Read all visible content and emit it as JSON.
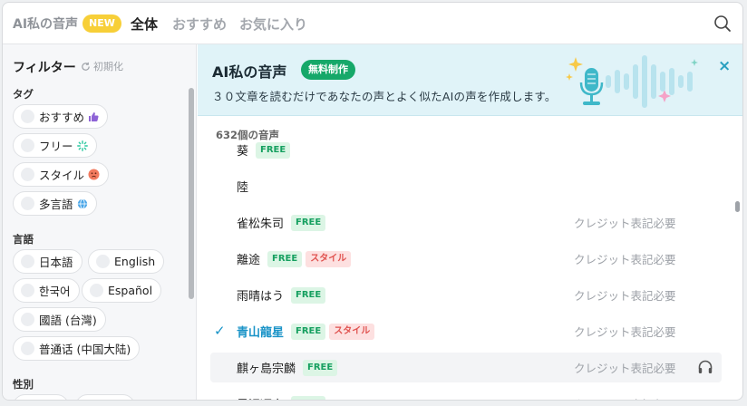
{
  "topbar": {
    "brand": "AI私の音声",
    "new_badge": "NEW",
    "tabs": [
      "全体",
      "おすすめ",
      "お気に入り"
    ]
  },
  "sidebar": {
    "filter_title": "フィルター",
    "reset_label": "初期化",
    "tag_section": "タグ",
    "tags": [
      "おすすめ",
      "フリー",
      "スタイル",
      "多言語"
    ],
    "language_section": "言語",
    "languages": [
      "日本語",
      "English",
      "한국어",
      "Español",
      "國語 (台灣)",
      "普通话 (中国大陆)"
    ],
    "gender_section": "性別"
  },
  "banner": {
    "title": "AI私の音声",
    "free_badge": "無料制作",
    "description": "３０文章を読むだけであなたの声とよく似たAIの声を作成します。",
    "close": "×"
  },
  "list": {
    "count": "632個の音声",
    "free_tag": "FREE",
    "style_tag": "スタイル",
    "credit_text": "クレジット表記必要",
    "rows": [
      {
        "name": "葵",
        "free": true,
        "style": false,
        "credit": false
      },
      {
        "name": "陸",
        "free": false,
        "style": false,
        "credit": false
      },
      {
        "name": "雀松朱司",
        "free": true,
        "style": false,
        "credit": true
      },
      {
        "name": "離途",
        "free": true,
        "style": true,
        "credit": true
      },
      {
        "name": "雨晴はう",
        "free": true,
        "style": false,
        "credit": true
      },
      {
        "name": "青山龍星",
        "free": true,
        "style": true,
        "credit": true,
        "selected": true
      },
      {
        "name": "麒ヶ島宗麟",
        "free": true,
        "style": false,
        "credit": true,
        "hover": true
      },
      {
        "name": "黒沢冴白",
        "free": true,
        "style": false,
        "credit": true
      }
    ]
  },
  "colors": {
    "accent": "#1993c7",
    "banner_bg": "#e0f3f8",
    "free_green": "#16a060",
    "style_red": "#e0524f",
    "new_yellow": "#f7cf38"
  }
}
